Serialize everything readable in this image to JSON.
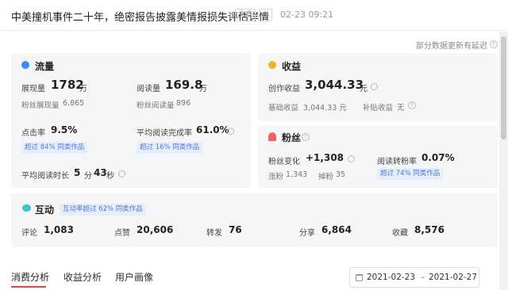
{
  "header": {
    "title": "中美撞机事件二十年，绝密报告披露美情报损失评估详情",
    "tag_label": "文章",
    "tag2_label": "AI",
    "time": "02-23 09:21"
  },
  "notice": "部分数据更新有延迟",
  "traffic": {
    "title": "流量",
    "impressions_label": "展现量",
    "impressions_value": "1782",
    "impressions_unit": "万",
    "fan_impressions_label": "粉丝展现量",
    "fan_impressions_value": "6,865",
    "reads_label": "阅读量",
    "reads_value": "169.8",
    "reads_unit": "万",
    "fan_reads_label": "粉丝阅读量",
    "fan_reads_value": "896",
    "ctr_label": "点击率",
    "ctr_value": "9.5%",
    "ctr_badge": "超过 84% 同类作品",
    "completion_label": "平均阅读完成率",
    "completion_value": "61.0%",
    "completion_badge": "超过 16% 同类作品",
    "duration_label": "平均阅读时长",
    "duration_min": "5",
    "duration_min_unit": "分",
    "duration_sec": "43",
    "duration_sec_unit": "秒"
  },
  "income": {
    "title": "收益",
    "creation_label": "创作收益",
    "creation_value": "3,044.33",
    "creation_unit": "元",
    "base_label": "基础收益",
    "base_value": "3,044.33 元",
    "subsidy_label": "补贴收益",
    "subsidy_value": "无"
  },
  "fans": {
    "title": "粉丝",
    "change_label": "粉丝变化",
    "change_value": "+1,308",
    "gain_label": "涨粉",
    "gain_value": "1,343",
    "loss_label": "掉粉",
    "loss_value": "35",
    "conv_label": "阅读转粉率",
    "conv_value": "0.07%",
    "conv_badge": "超过 74% 同类作品"
  },
  "interaction": {
    "title": "互动",
    "badge": "互动率超过 62% 同类作品",
    "items": [
      {
        "label": "评论",
        "value": "1,083"
      },
      {
        "label": "点赞",
        "value": "20,606"
      },
      {
        "label": "转发",
        "value": "76"
      },
      {
        "label": "分享",
        "value": "6,864"
      },
      {
        "label": "收藏",
        "value": "8,576"
      }
    ]
  },
  "tabs": [
    {
      "label": "消费分析"
    },
    {
      "label": "收益分析"
    },
    {
      "label": "用户画像"
    }
  ],
  "date_range": {
    "start": "2021-02-23",
    "separator": "–",
    "end": "2021-02-27"
  },
  "colors": {
    "traffic_icon": "#3d8bf2",
    "income_icon": "#f5b326",
    "fans_icon": "#f06262",
    "interaction_icon": "#3cc6c6",
    "accent_underline": "#e5454a",
    "badge_text": "#4a79d6"
  }
}
